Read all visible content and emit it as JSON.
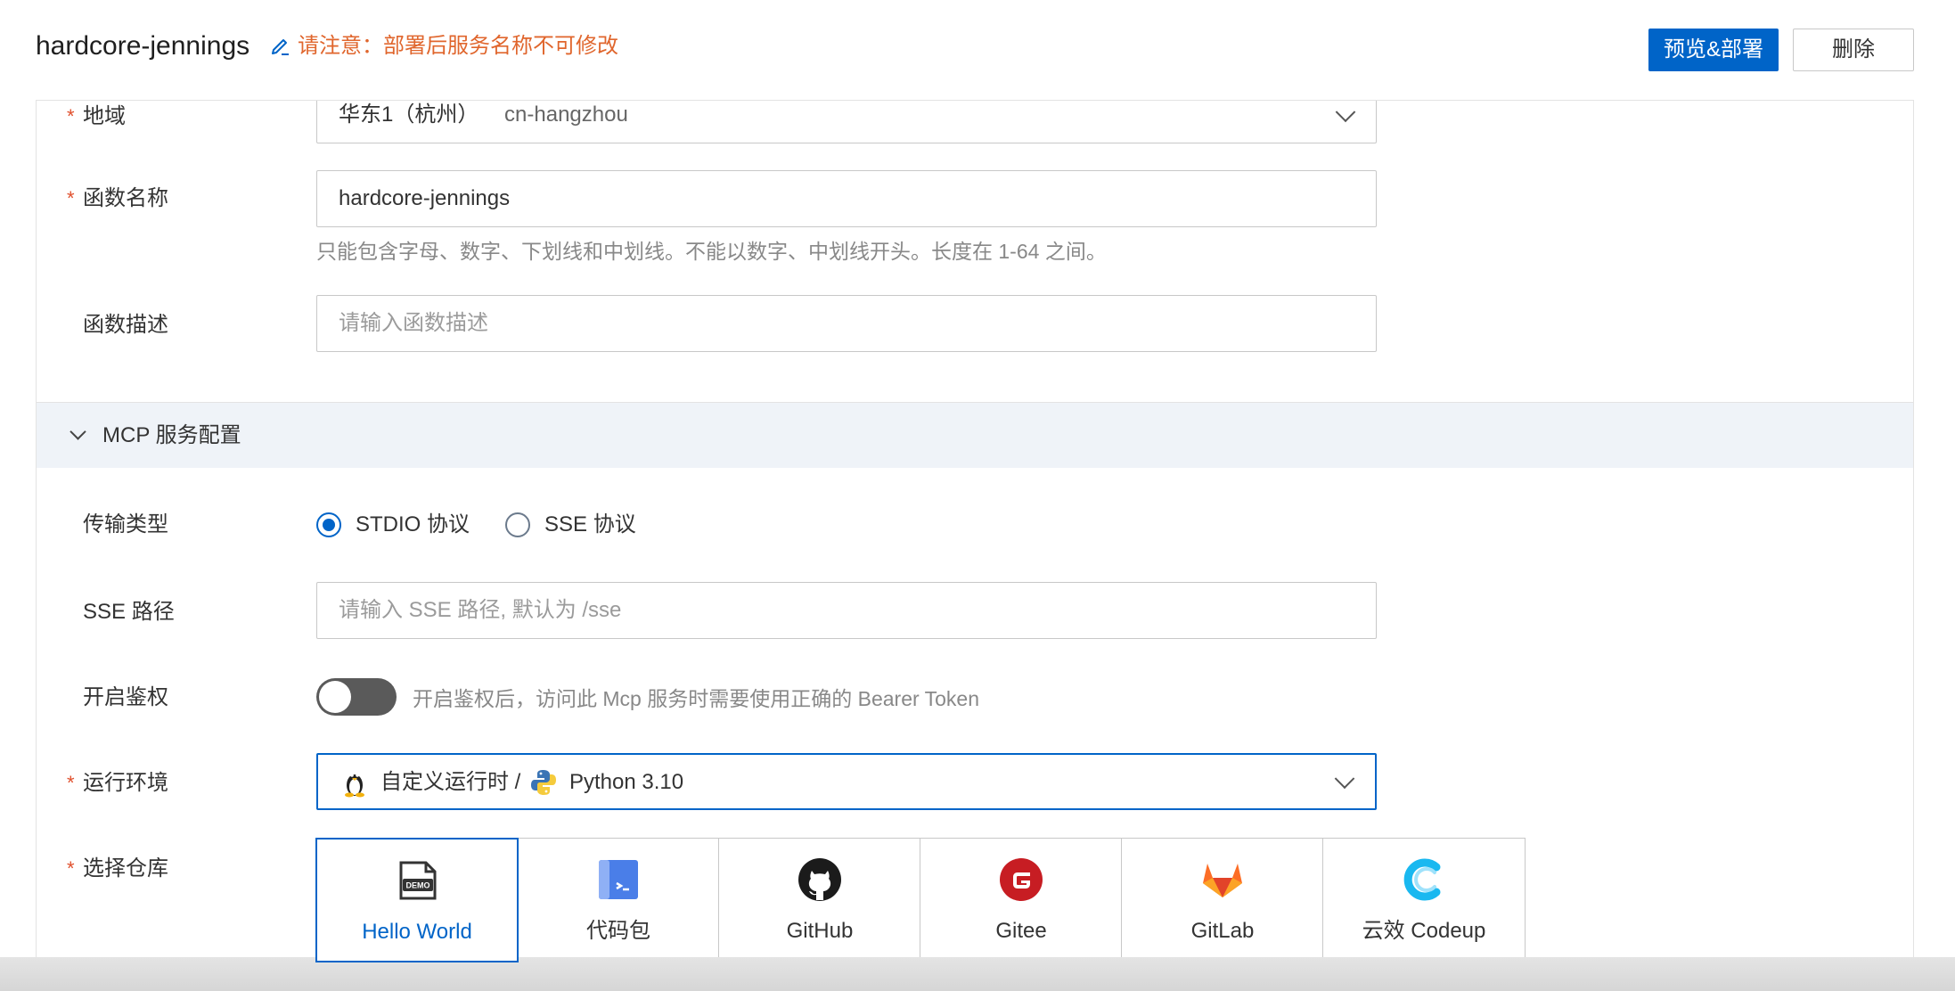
{
  "header": {
    "title": "hardcore-jennings",
    "notice": "请注意：部署后服务名称不可修改",
    "preview_deploy_label": "预览&部署",
    "delete_label": "删除"
  },
  "form": {
    "required_mark": "*",
    "region": {
      "label": "地域",
      "value_cn": "华东1（杭州）",
      "value_id": "cn-hangzhou"
    },
    "function_name": {
      "label": "函数名称",
      "value": "hardcore-jennings",
      "help": "只能包含字母、数字、下划线和中划线。不能以数字、中划线开头。长度在 1-64 之间。"
    },
    "function_desc": {
      "label": "函数描述",
      "placeholder": "请输入函数描述"
    }
  },
  "mcp": {
    "section_title": "MCP 服务配置",
    "transport": {
      "label": "传输类型",
      "options": [
        "STDIO 协议",
        "SSE 协议"
      ],
      "selected": "STDIO 协议"
    },
    "sse_path": {
      "label": "SSE 路径",
      "placeholder": "请输入 SSE 路径, 默认为 /sse"
    },
    "auth": {
      "label": "开启鉴权",
      "enabled": false,
      "help": "开启鉴权后，访问此 Mcp 服务时需要使用正确的 Bearer Token"
    },
    "runtime": {
      "label": "运行环境",
      "value_custom": "自定义运行时 /",
      "value_lang": "Python 3.10"
    },
    "repo": {
      "label": "选择仓库",
      "selected": "Hello World",
      "options": [
        {
          "label": "Hello World",
          "icon": "demo-icon"
        },
        {
          "label": "代码包",
          "icon": "code-package-icon"
        },
        {
          "label": "GitHub",
          "icon": "github-icon"
        },
        {
          "label": "Gitee",
          "icon": "gitee-icon"
        },
        {
          "label": "GitLab",
          "icon": "gitlab-icon"
        },
        {
          "label": "云效 Codeup",
          "icon": "codeup-icon"
        }
      ]
    }
  },
  "colors": {
    "primary": "#0064c8",
    "notice": "#e0662d",
    "required": "#e0502d",
    "section_bg": "#eff3f8"
  }
}
